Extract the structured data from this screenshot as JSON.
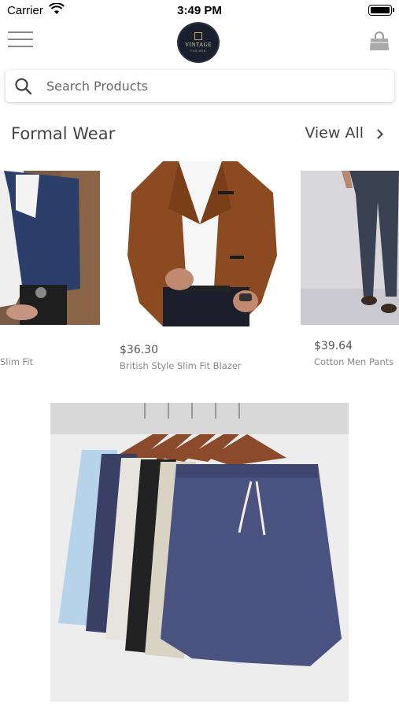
{
  "status_bar": {
    "carrier": "Carrier",
    "time": "3:49 PM"
  },
  "nav": {
    "logo_brand": "VINTAGE",
    "logo_sub": "FOR MEN"
  },
  "search": {
    "placeholder": "Search Products"
  },
  "section": {
    "title": "Formal Wear",
    "view_all": "View All"
  },
  "products": [
    {
      "price": "",
      "name": "Slim Fit"
    },
    {
      "price": "$36.30",
      "name": "British Style Slim Fit Blazer"
    },
    {
      "price": "$39.64",
      "name": "Cotton Men Pants"
    }
  ],
  "colors": {
    "logo_bg": "#1a1f2e",
    "text_primary": "#444444",
    "text_secondary": "#888888"
  }
}
